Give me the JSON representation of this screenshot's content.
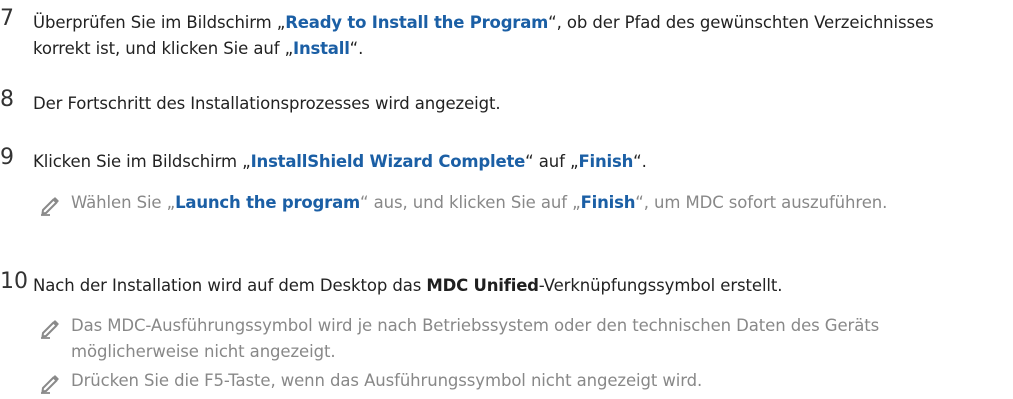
{
  "steps": [
    {
      "number": "7",
      "parts": [
        {
          "text": "Überprüfen Sie im Bildschirm „",
          "style": "plain"
        },
        {
          "text": "Ready to Install the Program",
          "style": "highlight"
        },
        {
          "text": "“, ob der Pfad des gewünschten Verzeichnisses korrekt ist, und klicken Sie auf „",
          "style": "plain"
        },
        {
          "text": "Install",
          "style": "highlight"
        },
        {
          "text": "“.",
          "style": "plain"
        }
      ],
      "notes": []
    },
    {
      "number": "8",
      "parts": [
        {
          "text": "Der Fortschritt des Installationsprozesses wird angezeigt.",
          "style": "plain"
        }
      ],
      "notes": []
    },
    {
      "number": "9",
      "parts": [
        {
          "text": "Klicken Sie im Bildschirm „",
          "style": "plain"
        },
        {
          "text": "InstallShield Wizard Complete",
          "style": "highlight"
        },
        {
          "text": "“ auf „",
          "style": "plain"
        },
        {
          "text": "Finish",
          "style": "highlight"
        },
        {
          "text": "“.",
          "style": "plain"
        }
      ],
      "notes": [
        {
          "icon": "pencil-icon",
          "parts": [
            {
              "text": "Wählen Sie „",
              "style": "plain"
            },
            {
              "text": "Launch the program",
              "style": "highlight"
            },
            {
              "text": "“ aus, und klicken Sie auf „",
              "style": "plain"
            },
            {
              "text": "Finish",
              "style": "highlight"
            },
            {
              "text": "“, um MDC sofort auszuführen.",
              "style": "plain"
            }
          ]
        }
      ]
    },
    {
      "number": "10",
      "parts": [
        {
          "text": "Nach der Installation wird auf dem Desktop das ",
          "style": "plain"
        },
        {
          "text": "MDC Unified",
          "style": "strong"
        },
        {
          "text": "-Verknüpfungssymbol erstellt.",
          "style": "plain"
        }
      ],
      "notes": [
        {
          "icon": "pencil-icon",
          "parts": [
            {
              "text": "Das MDC-Ausführungssymbol wird je nach Betriebssystem oder den technischen Daten des Geräts möglicherweise nicht angezeigt.",
              "style": "plain"
            }
          ]
        },
        {
          "icon": "pencil-icon",
          "parts": [
            {
              "text": "Drücken Sie die F5-Taste, wenn das Ausführungssymbol nicht angezeigt wird.",
              "style": "plain"
            }
          ]
        }
      ]
    }
  ],
  "colors": {
    "highlight": "#1b5fa5",
    "body_text": "#222222",
    "note_text": "#888888",
    "icon": "#8a8a8a"
  }
}
